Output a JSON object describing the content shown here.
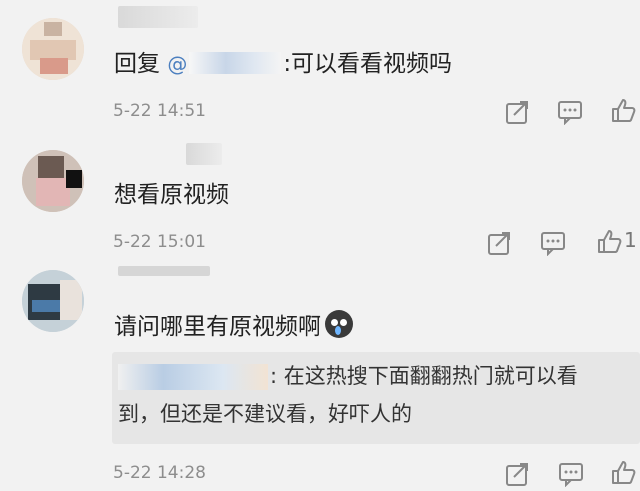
{
  "comments": [
    {
      "text_prefix": "回复",
      "at_symbol": "@",
      "text_suffix": ":可以看看视频吗",
      "time": "5-22 14:51",
      "icons": {
        "share": "share-icon",
        "comment": "comment-icon",
        "like": "thumbs-up-icon"
      }
    },
    {
      "text": "想看原视频",
      "time": "5-22 15:01",
      "like_count": "1",
      "icons": {
        "share": "share-icon",
        "comment": "comment-icon",
        "like": "thumbs-up-icon"
      }
    },
    {
      "text": "请问哪里有原视频啊",
      "emoji": "crying-face-emoji",
      "reply": {
        "line1": ": 在这热搜下面翻翻热门就可以看",
        "line2": "到，但还是不建议看，好吓人的"
      },
      "time": "5-22 14:28",
      "icons": {
        "share": "share-icon",
        "comment": "comment-icon",
        "like": "thumbs-up-icon"
      }
    }
  ]
}
